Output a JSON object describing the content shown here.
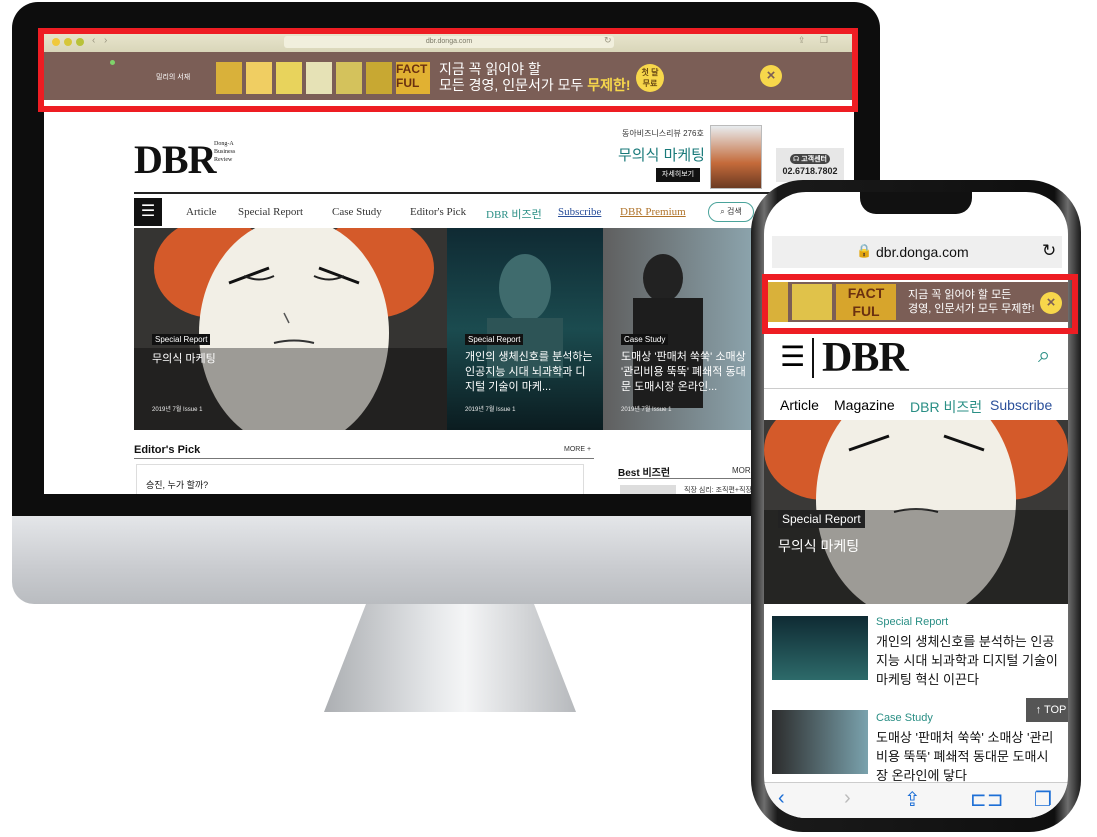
{
  "desktop": {
    "url": "dbr.donga.com",
    "banner": {
      "brand": "밀리의 서재",
      "line1": "지금 꼭 읽어야 할",
      "line2_prefix": "모든 경영, 인문서가 모두 ",
      "line2_highlight": "무제한!",
      "badge_line1": "첫 달",
      "badge_line2": "무료",
      "close_icon": "close-icon"
    },
    "header": {
      "logo": "DBR",
      "logo_sub_1": "Dong-A",
      "logo_sub_2": "Business",
      "logo_sub_3": "Review",
      "issue": "동아비즈니스리뷰 276호",
      "issue_title": "무의식 마케팅",
      "more_button": "자세히보기",
      "cs_label": "고객센터",
      "cs_phone": "02.6718.7802"
    },
    "nav": {
      "items": [
        "Article",
        "Special Report",
        "Case Study",
        "Editor's Pick",
        "DBR 비즈런",
        "Subscribe",
        "DBR Premium"
      ],
      "search": "검색"
    },
    "hero": [
      {
        "label": "Special Report",
        "title": "무의식 마케팅",
        "date": "2019년 7월 Issue 1"
      },
      {
        "label": "Special Report",
        "title": "개인의 생체신호를 분석하는 인공지능 시대 뇌과학과 디지털 기술이 마케...",
        "date": "2019년 7월 Issue 1"
      },
      {
        "label": "Case Study",
        "title": "도매상 '판매처 쑥쑥' 소매상 '관리비용 뚝뚝' 폐쇄적 동대문 도매시장 온라인...",
        "date": "2019년 7월 Issue 1"
      }
    ],
    "editors_pick": {
      "title": "Editor's Pick",
      "more": "MORE +",
      "item": "승진, 누가 할까?"
    },
    "best": {
      "title": "Best 비즈런",
      "more": "MORE",
      "item": "직장 심리: 조직편+직장"
    }
  },
  "mobile": {
    "url": "dbr.donga.com",
    "banner": {
      "line1": "지금 꼭 읽어야 할 모든",
      "line2": "경영, 인문서가 모두 무제한!"
    },
    "logo": "DBR",
    "nav": [
      "Article",
      "Magazine",
      "DBR 비즈런",
      "Subscribe"
    ],
    "hero": {
      "label": "Special Report",
      "title": "무의식 마케팅"
    },
    "items": [
      {
        "label": "Special Report",
        "title": "개인의 생체신호를 분석하는 인공지능 시대 뇌과학과 디지털 기술이 마케팅 혁신 이끈다"
      },
      {
        "label": "Case Study",
        "title": "도매상 '판매처 쑥쑥' 소매상 '관리비용 뚝뚝' 폐쇄적 동대문 도매시장 온라인에 닿다"
      }
    ],
    "top_button": "TOP"
  },
  "colors": {
    "banner": "#7b5e56",
    "accent": "#f7d74b",
    "teal": "#1a7a7a",
    "highlight": "#ee1d23"
  }
}
